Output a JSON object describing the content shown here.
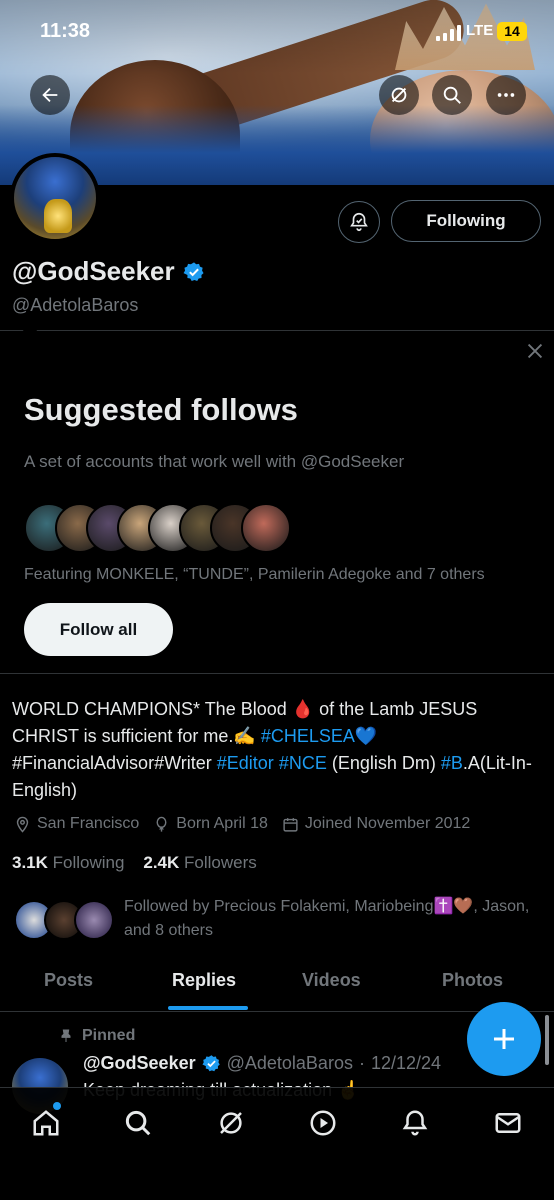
{
  "status_bar": {
    "time": "11:38",
    "network": "LTE",
    "battery": "14"
  },
  "profile": {
    "display_name": "@GodSeeker",
    "handle": "@AdetolaBaros",
    "following_button": "Following",
    "bio_parts": {
      "p1": "WORLD CHAMPIONS* The Blood ",
      "blood_emoji": "🩸",
      "p2": " of the Lamb JESUS CHRIST is sufficient for me.",
      "writing_emoji": "✍",
      "hashtag_chelsea": "#CHELSEA",
      "heart_emoji": "💙",
      "p3": "#FinancialAdvisor#Writer ",
      "hashtag_editor": "#Editor",
      "hashtag_nce": "#NCE",
      "p4": " (English Dm) ",
      "hashtag_b": "#B",
      "p5": ".A(Lit-In-English)"
    },
    "location": "San Francisco",
    "birthday": "Born April 18",
    "joined": "Joined November 2012",
    "following_count": "3.1K",
    "following_label": "Following",
    "followers_count": "2.4K",
    "followers_label": "Followers",
    "followed_by": "Followed by Precious Folakemi, Mariobeing✝️🤎, Jason, and 8 others"
  },
  "suggested": {
    "title": "Suggested follows",
    "subtitle": "A set of accounts that work well with @GodSeeker",
    "featuring": "Featuring MONKELE, “TUNDE”, Pamilerin Adegoke and 7 others",
    "follow_all": "Follow all",
    "avatar_colors": [
      "#3b6e7a",
      "#8a6a4a",
      "#5a4a6a",
      "#c9a57a",
      "#d9d0c8",
      "#6a5a3a",
      "#4a3528",
      "#c06a5a"
    ]
  },
  "tabs": [
    "Posts",
    "Replies",
    "Videos",
    "Photos"
  ],
  "active_tab": "Replies",
  "pinned_post": {
    "pinned_label": "Pinned",
    "author_name": "@GodSeeker",
    "author_handle": "@AdetolaBaros",
    "date": "12/12/24",
    "separator": "·",
    "text": "Keep dreaming till actualization ☝️"
  },
  "colors": {
    "accent": "#1d9bf0",
    "background": "#000000",
    "muted": "#71767b",
    "text": "#e7e9ea"
  },
  "icons": [
    "back-arrow-icon",
    "grok-icon",
    "search-icon",
    "more-icon",
    "notification-bell-icon",
    "verified-badge-icon",
    "close-icon",
    "location-pin-icon",
    "balloon-icon",
    "calendar-icon",
    "pin-icon",
    "plus-icon",
    "home-icon",
    "search-nav-icon",
    "grok-nav-icon",
    "video-icon",
    "bell-nav-icon",
    "mail-icon"
  ]
}
